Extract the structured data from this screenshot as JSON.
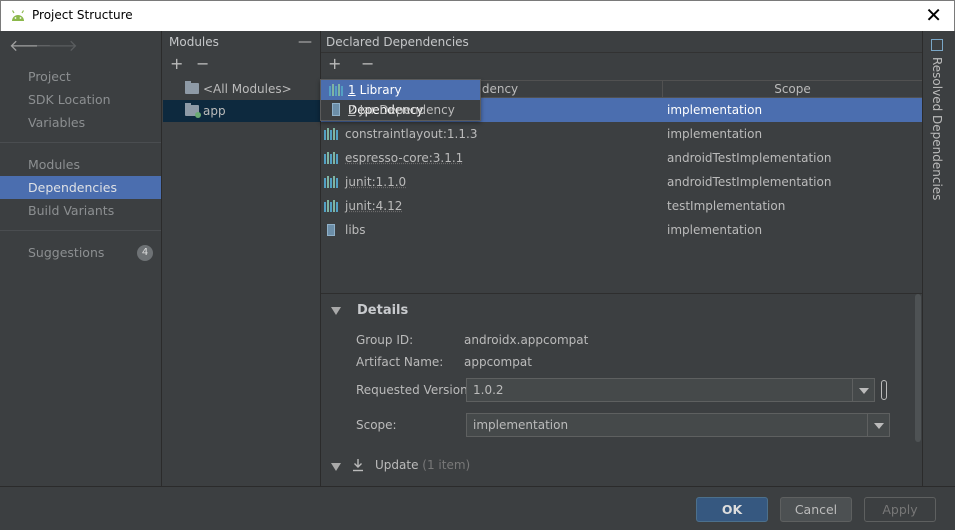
{
  "window": {
    "title": "Project Structure",
    "close_glyph": "✕"
  },
  "nav": {
    "back_glyph": "🡐",
    "forward_glyph": "🡒",
    "items": [
      {
        "label": "Project"
      },
      {
        "label": "SDK Location"
      },
      {
        "label": "Variables"
      },
      {
        "label": "Modules"
      },
      {
        "label": "Dependencies"
      },
      {
        "label": "Build Variants"
      },
      {
        "label": "Suggestions",
        "badge": "4"
      }
    ]
  },
  "modules": {
    "header": "Modules",
    "collapse_glyph": "—",
    "add_glyph": "+",
    "remove_glyph": "−",
    "items": [
      {
        "label": "<All Modules>"
      },
      {
        "label": "app"
      }
    ]
  },
  "dependencies": {
    "header": "Declared Dependencies",
    "add_glyph": "+",
    "remove_glyph": "−",
    "columns": {
      "dependency": "Dependency",
      "dependency_visible": "endency",
      "scope": "Scope"
    },
    "rows": [
      {
        "name": "",
        "scope": "implementation",
        "icon": "library-icon"
      },
      {
        "name": "constraintlayout:1.1.3",
        "scope": "implementation",
        "icon": "library-icon"
      },
      {
        "name": "espresso-core:3.1.1",
        "scope": "androidTestImplementation",
        "icon": "library-icon"
      },
      {
        "name": "junit:1.1.0",
        "scope": "androidTestImplementation",
        "icon": "library-icon"
      },
      {
        "name": "junit:4.12",
        "scope": "testImplementation",
        "icon": "library-icon"
      },
      {
        "name": "libs",
        "scope": "implementation",
        "icon": "jar-icon"
      }
    ]
  },
  "add_menu": {
    "items": [
      {
        "mnemonic": "1",
        "label": "Library Dependency",
        "icon": "library-icon"
      },
      {
        "mnemonic": "2",
        "label": "Jar Dependency",
        "icon": "jar-icon"
      }
    ]
  },
  "details": {
    "header": "Details",
    "group_id_label": "Group ID:",
    "group_id_value": "androidx.appcompat",
    "artifact_label": "Artifact Name:",
    "artifact_value": "appcompat",
    "version_label": "Requested Version:",
    "version_value": "1.0.2",
    "scope_label": "Scope:",
    "scope_value": "implementation",
    "update_label": "Update",
    "update_count": "(1 item)"
  },
  "right_strip": {
    "label": "Resolved Dependencies"
  },
  "buttons": {
    "ok": "OK",
    "cancel": "Cancel",
    "apply": "Apply"
  }
}
